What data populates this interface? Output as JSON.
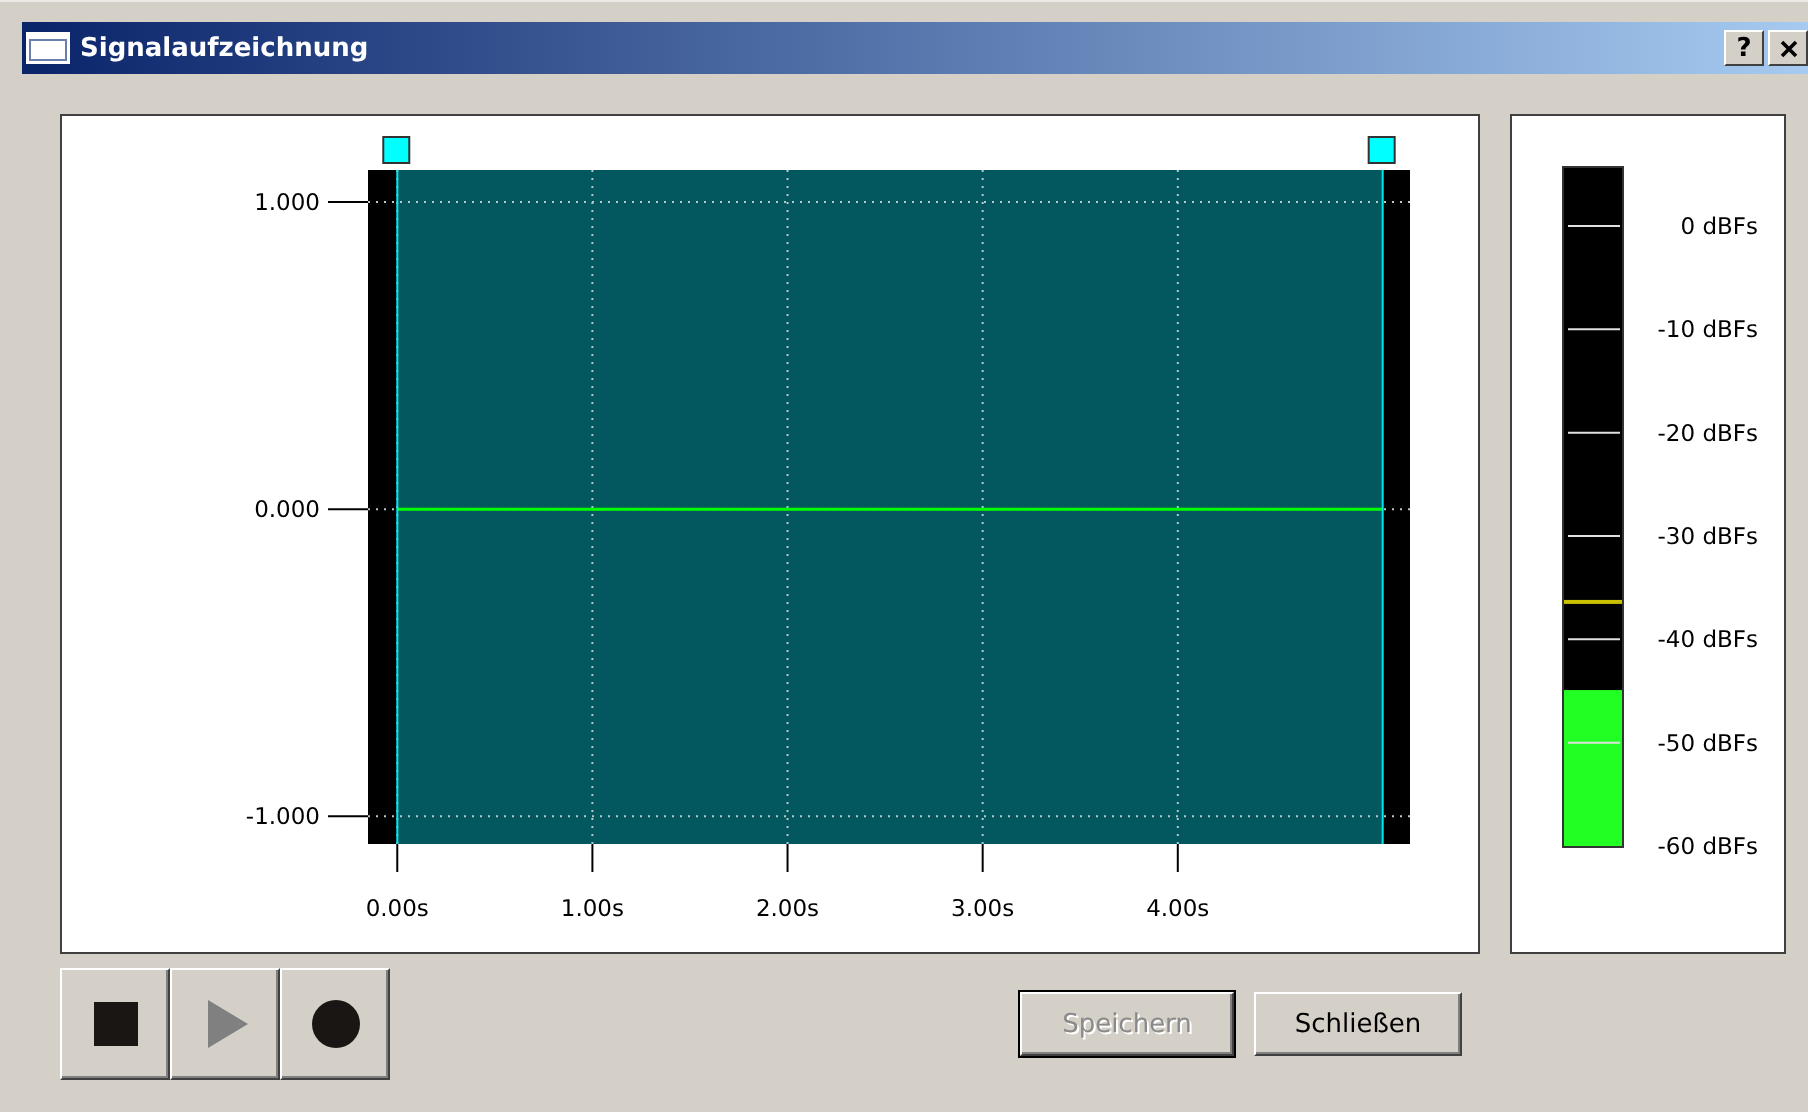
{
  "window": {
    "title": "Signalaufzeichnung",
    "help_label": "?"
  },
  "chart": {
    "chart_data": {
      "type": "line",
      "x": [
        0,
        5.05
      ],
      "xlim": [
        -0.15,
        5.19
      ],
      "ylim": [
        -1.09,
        1.104
      ],
      "series": [
        {
          "color": "#00ff00",
          "values": [
            0,
            0
          ]
        }
      ],
      "grid": true,
      "xticks": [
        {
          "value": 0,
          "label": "0.00s"
        },
        {
          "value": 1,
          "label": "1.00s"
        },
        {
          "value": 2,
          "label": "2.00s"
        },
        {
          "value": 3,
          "label": "3.00s"
        },
        {
          "value": 4,
          "label": "4.00s"
        }
      ],
      "yticks": [
        {
          "value": 1,
          "label": "1.000"
        },
        {
          "value": 0,
          "label": "0.000"
        },
        {
          "value": -1,
          "label": "-1.000"
        }
      ],
      "bands": [
        {
          "axis": "x",
          "from": 0,
          "to": 5.05
        }
      ],
      "ref_lines": [
        {
          "axis": "x",
          "value": 0
        },
        {
          "axis": "x",
          "value": 5.05
        }
      ]
    }
  },
  "meter": {
    "labels": [
      "0 dBFs",
      "-10 dBFs",
      "-20 dBFs",
      "-30 dBFs",
      "-40 dBFs",
      "-50 dBFs",
      "-60 dBFs"
    ],
    "level": 0.23,
    "peak": {
      "level": 0.36
    }
  },
  "transport": [
    {
      "kind": "stop",
      "disabled": false
    },
    {
      "kind": "play",
      "disabled": true
    },
    {
      "kind": "record",
      "disabled": false
    }
  ],
  "buttons": [
    {
      "label": "Speichern",
      "disabled": true,
      "default": true
    },
    {
      "label": "Schließen",
      "disabled": false,
      "default": false
    }
  ]
}
